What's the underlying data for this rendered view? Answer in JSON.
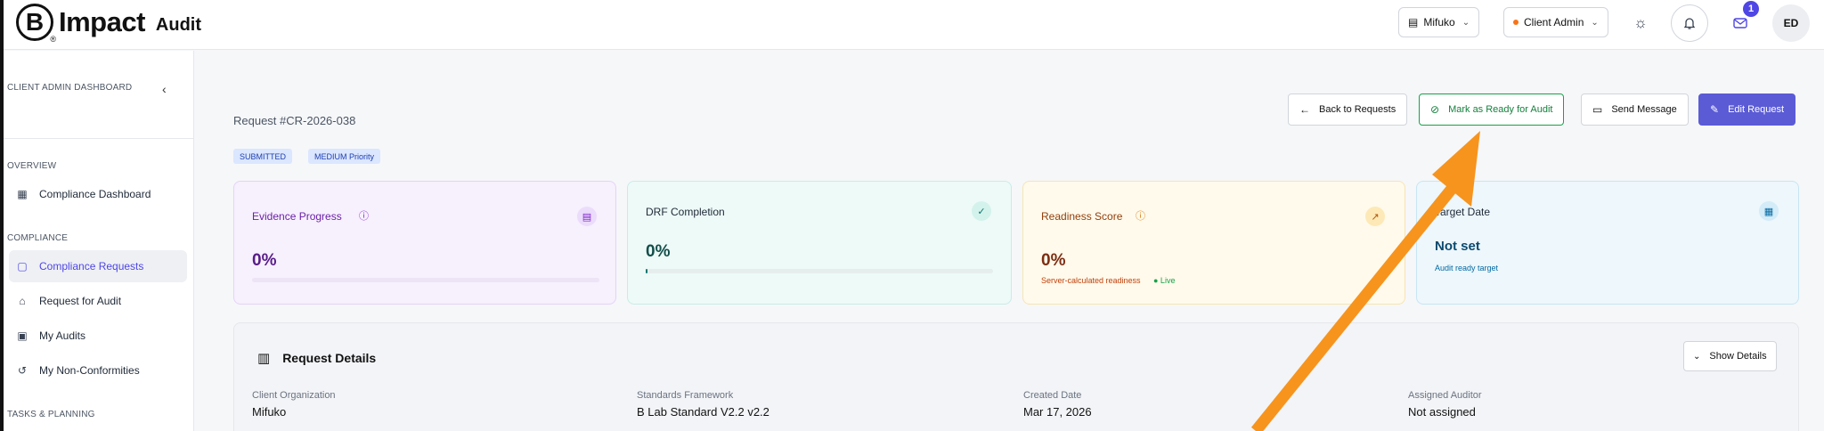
{
  "header": {
    "logo_letter": "B",
    "logo_reg": "®",
    "logo_text": "Impact",
    "logo_sub": "Audit",
    "org_select": "Mifuko",
    "role_select": "Client Admin",
    "notification_count": "1",
    "avatar_initials": "ED"
  },
  "sidebar": {
    "section_dashboard": "CLIENT ADMIN DASHBOARD",
    "collapse_icon": "‹",
    "section_overview": "OVERVIEW",
    "section_compliance": "COMPLIANCE",
    "section_tasks": "TASKS & PLANNING",
    "items": [
      {
        "label": "Compliance Dashboard",
        "icon": "grid-icon"
      },
      {
        "label": "Compliance Requests",
        "icon": "document-icon"
      },
      {
        "label": "Request for Audit",
        "icon": "building-icon"
      },
      {
        "label": "My Audits",
        "icon": "clipboard-icon"
      },
      {
        "label": "My Non-Conformities",
        "icon": "history-icon"
      }
    ]
  },
  "request": {
    "title": "Request #CR-2026-038",
    "status_tag": "SUBMITTED",
    "priority_tag": "MEDIUM Priority"
  },
  "actions": {
    "back": "Back to Requests",
    "mark_ready": "Mark as Ready for Audit",
    "send_message": "Send Message",
    "edit": "Edit Request"
  },
  "cards": {
    "evidence": {
      "title": "Evidence Progress",
      "value": "0%",
      "progress": 0
    },
    "drf": {
      "title": "DRF Completion",
      "value": "0%",
      "progress": 0
    },
    "readiness": {
      "title": "Readiness Score",
      "value": "0%",
      "note": "Server-calculated readiness",
      "live": "● Live"
    },
    "target": {
      "title": "Target Date",
      "value": "Not set",
      "note": "Audit ready target"
    }
  },
  "details": {
    "title": "Request Details",
    "show_button": "Show Details",
    "fields": [
      {
        "label": "Client Organization",
        "value": "Mifuko"
      },
      {
        "label": "Standards Framework",
        "value": "B Lab Standard V2.2 v2.2"
      },
      {
        "label": "Created Date",
        "value": "Mar 17, 2026"
      },
      {
        "label": "Assigned Auditor",
        "value": "Not assigned"
      }
    ]
  },
  "colors": {
    "primary": "#5b5bd6",
    "green": "#16a34a",
    "annotation_arrow": "#f7941d"
  }
}
